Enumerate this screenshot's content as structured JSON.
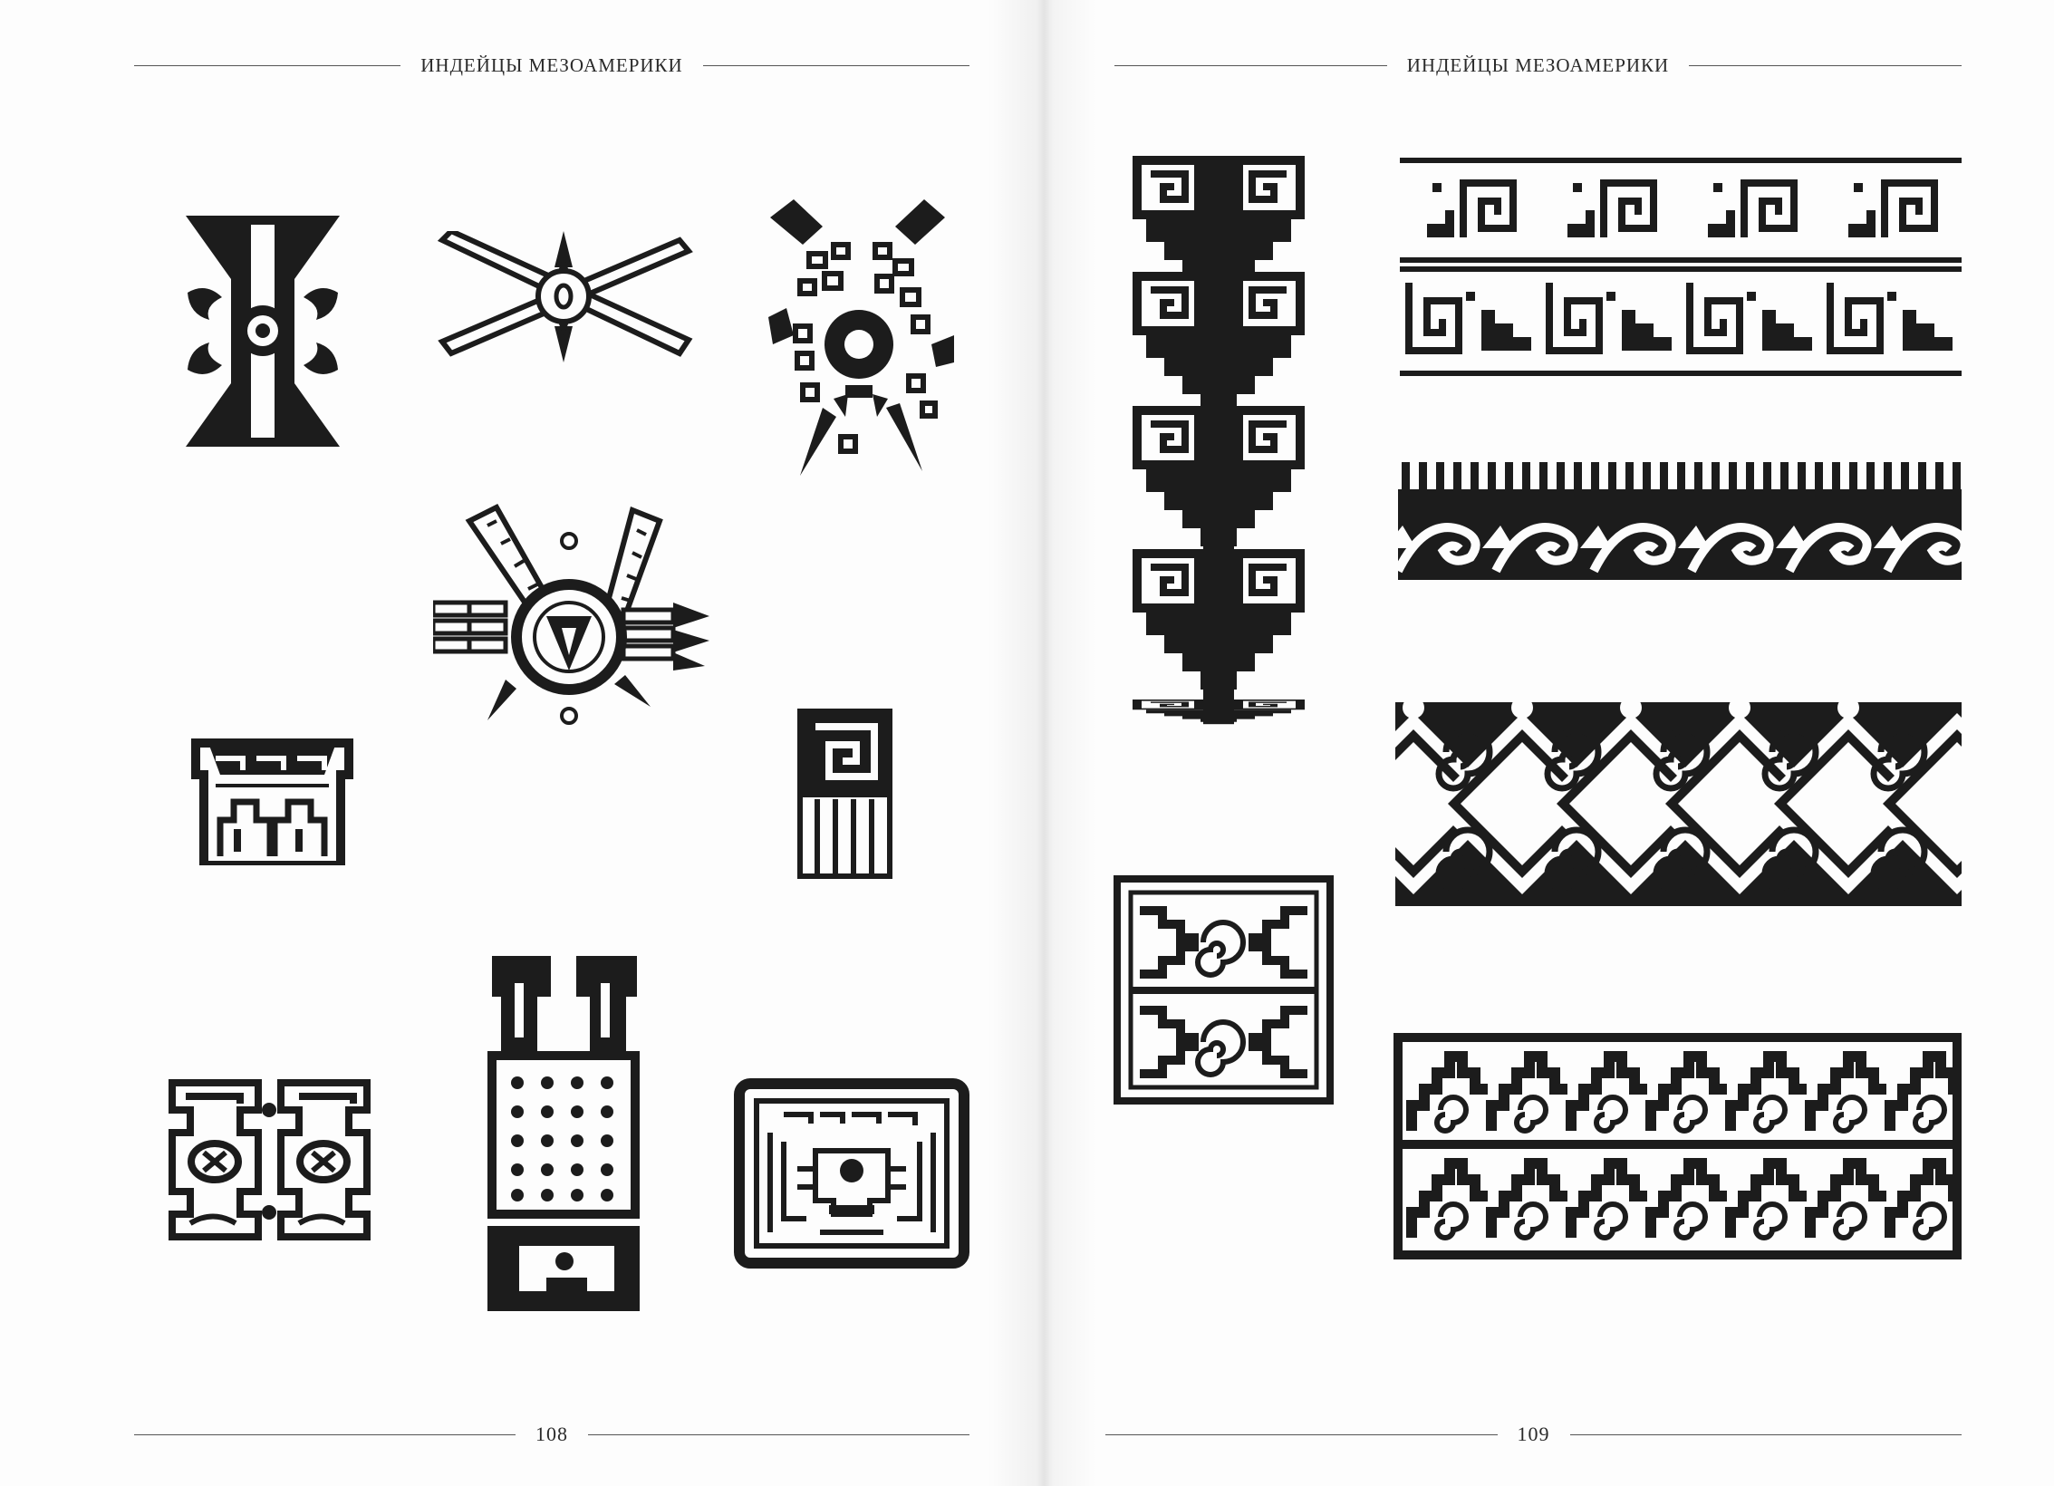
{
  "left_page": {
    "running_head": "ИНДЕЙЦЫ МЕЗОАМЕРИКИ",
    "page_number": "108"
  },
  "right_page": {
    "running_head": "ИНДЕЙЦЫ МЕЗОАМЕРИКИ",
    "page_number": "109"
  },
  "colors": {
    "ink": "#1c1c1c",
    "paper": "#fdfdfd"
  }
}
